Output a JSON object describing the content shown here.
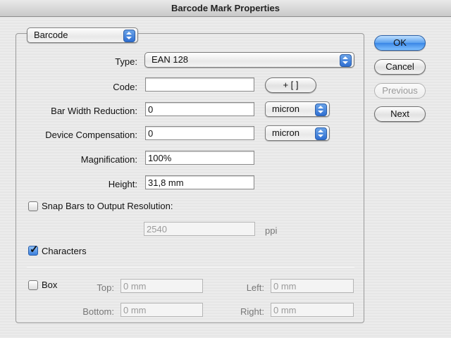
{
  "window": {
    "title": "Barcode Mark Properties"
  },
  "group_popup": {
    "value": "Barcode"
  },
  "type": {
    "label": "Type:",
    "value": "EAN 128"
  },
  "code": {
    "label": "Code:",
    "value": "",
    "button": "+ [ ]"
  },
  "bar_width_reduction": {
    "label": "Bar Width Reduction:",
    "value": "0",
    "unit": "micron"
  },
  "device_compensation": {
    "label": "Device Compensation:",
    "value": "0",
    "unit": "micron"
  },
  "magnification": {
    "label": "Magnification:",
    "value": "100%"
  },
  "height": {
    "label": "Height:",
    "value": "31,8 mm"
  },
  "snap_bars": {
    "label": "Snap Bars to Output Resolution:",
    "checked": false,
    "value": "2540",
    "unit": "ppi"
  },
  "characters": {
    "label": "Characters",
    "checked": true
  },
  "box": {
    "label": "Box",
    "checked": false,
    "top_label": "Top:",
    "top_value": "0 mm",
    "left_label": "Left:",
    "left_value": "0 mm",
    "bottom_label": "Bottom:",
    "bottom_value": "0 mm",
    "right_label": "Right:",
    "right_value": "0 mm"
  },
  "buttons": {
    "ok": "OK",
    "cancel": "Cancel",
    "previous": "Previous",
    "next": "Next"
  },
  "colors": {
    "accent": "#3a86e6",
    "disabled_text": "#9a9a9a"
  }
}
